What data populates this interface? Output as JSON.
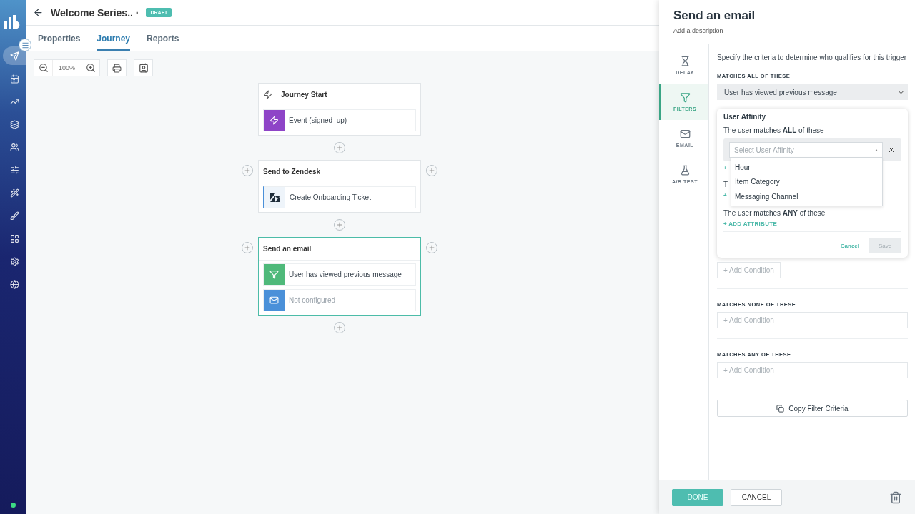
{
  "nav": [
    {
      "selected": true
    },
    {
      "selected": false
    },
    {
      "selected": false
    },
    {
      "selected": false
    },
    {
      "selected": false
    },
    {
      "selected": false
    },
    {
      "selected": false
    },
    {
      "selected": false
    },
    {
      "selected": false
    },
    {
      "selected": false
    },
    {
      "selected": false
    }
  ],
  "status_online": true,
  "header": {
    "title": "Welcome Series.. ·",
    "status": "DRAFT"
  },
  "tabs": [
    {
      "label": "Properties",
      "selected": false
    },
    {
      "label": "Journey",
      "selected": true
    },
    {
      "label": "Reports",
      "selected": false
    }
  ],
  "toolbar": {
    "zoom": "100%"
  },
  "journey": {
    "nodes": [
      {
        "title": "Journey Start",
        "kind": "start",
        "selected": false,
        "steps": [
          {
            "kind": "event",
            "text": "Event (signed_up)",
            "configured": true
          }
        ]
      },
      {
        "title": "Send to Zendesk",
        "kind": "step",
        "selected": false,
        "steps": [
          {
            "kind": "zendesk",
            "text": "Create Onboarding Ticket",
            "configured": true
          }
        ]
      },
      {
        "title": "Send an email",
        "kind": "step",
        "selected": true,
        "steps": [
          {
            "kind": "filter",
            "text": "User has viewed previous message",
            "configured": true
          },
          {
            "kind": "email",
            "text": "Not configured",
            "configured": false
          }
        ]
      }
    ]
  },
  "panel": {
    "title": "Send an email",
    "description": "Add a description",
    "tabs": [
      {
        "label": "DELAY",
        "selected": false
      },
      {
        "label": "FILTERS",
        "selected": true
      },
      {
        "label": "EMAIL",
        "selected": false
      },
      {
        "label": "A/B TEST",
        "selected": false
      }
    ],
    "intro": "Specify the criteria to determine who qualifies for this trigger",
    "all_label": "MATCHES ALL OF THESE",
    "all_select": "User has viewed previous message",
    "affinity": {
      "title": "User Affinity",
      "all_text": "The user matches **ALL** of these",
      "select_placeholder": "Select User Affinity",
      "options": [
        "Hour",
        "Item Category",
        "Messaging Channel"
      ],
      "add_partial": "+",
      "none_partial": "T",
      "none_add_partial": "+",
      "any_text": "The user matches **ANY** of these",
      "any_add": "+ ADD ATTRIBUTE",
      "cancel": "Cancel",
      "save": "Save",
      "save_disabled": true
    },
    "all_add": "+ Add Condition",
    "groups": [
      {
        "label": "MATCHES NONE OF THESE",
        "add": "+ Add Condition"
      },
      {
        "label": "MATCHES ANY OF THESE",
        "add": "+ Add Condition"
      }
    ],
    "copy": "Copy Filter Criteria",
    "done": "DONE",
    "cancel": "CANCEL"
  }
}
